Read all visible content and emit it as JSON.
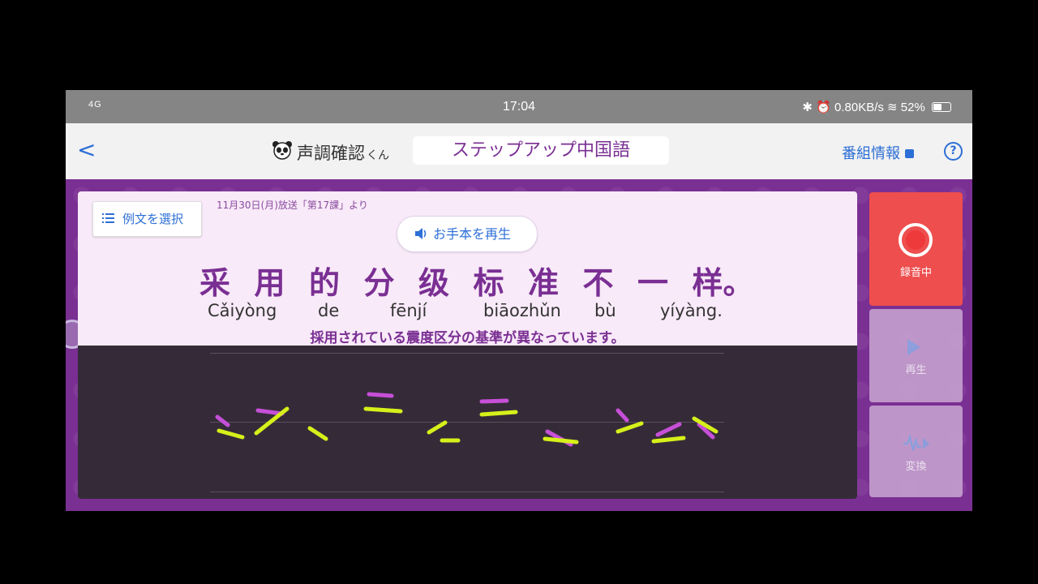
{
  "status": {
    "signal": "4G",
    "time": "17:04",
    "speed": "0.80KB/s",
    "battery": "52%"
  },
  "nav": {
    "back": "<",
    "app_title": "声調確認",
    "app_suffix": "くん",
    "program": "ステップアップ中国語",
    "info": "番組情報",
    "help": "?"
  },
  "lesson": {
    "select_label": "例文を選択",
    "broadcast": "11月30日(月)放送「第17課」より",
    "play_model": "お手本を再生",
    "hanzi": [
      "采",
      "用",
      "的",
      "分",
      "级",
      "标",
      "准",
      "不",
      "一",
      "样。"
    ],
    "pinyin": [
      "Cǎiyòng",
      "de",
      "fēnjí",
      "biāozhǔn",
      "bù",
      "yíyàng."
    ],
    "translation": "採用されている震度区分の基準が異なっています。"
  },
  "side": {
    "record": "録音中",
    "play": "再生",
    "convert": "変換"
  },
  "colors": {
    "purple": "#7a2f93",
    "record_red": "#ee4e4e",
    "link_blue": "#2d6fd6",
    "pitch_model": "#c64fd8",
    "pitch_user": "#d6f01a"
  }
}
